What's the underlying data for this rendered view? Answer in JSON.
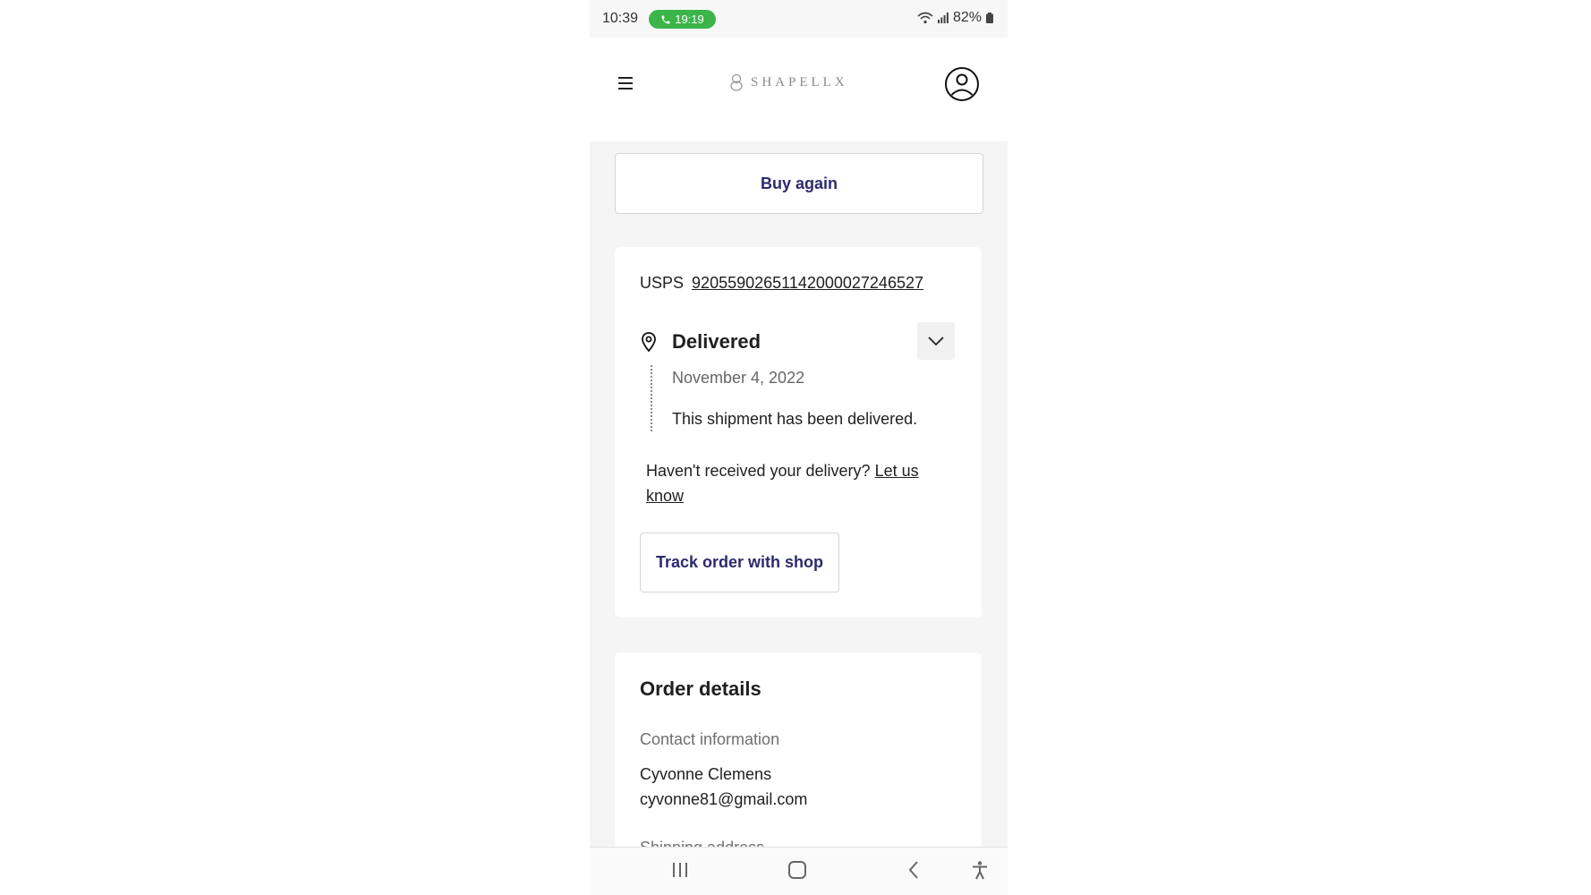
{
  "status_bar": {
    "time": "10:39",
    "call_duration": "19:19",
    "battery": "82%"
  },
  "header": {
    "brand": "SHAPELLX",
    "menu_icon": "hamburger-menu-icon",
    "account_icon": "user-account-icon"
  },
  "actions": {
    "buy_again": "Buy again",
    "track_order": "Track order with shop"
  },
  "shipment": {
    "carrier": "USPS",
    "tracking_number": "92055902651142000027246527",
    "status": "Delivered",
    "event_date": "November 4, 2022",
    "event_description": "This shipment has been delivered.",
    "not_received_text": "Haven't received your delivery?",
    "let_us_know_link": "Let us know"
  },
  "order_details": {
    "title": "Order details",
    "contact_label": "Contact information",
    "contact_name": "Cyvonne Clemens",
    "contact_email": "cyvonne81@gmail.com",
    "next_label_partial": "Shipping address"
  },
  "nav_bar": {
    "icons": [
      "recent-apps-icon",
      "home-icon",
      "back-icon",
      "accessibility-icon"
    ]
  },
  "colors": {
    "accent_text": "#2d2a6e",
    "call_badge": "#3bb54a",
    "page_bg": "#f5f5f5"
  }
}
